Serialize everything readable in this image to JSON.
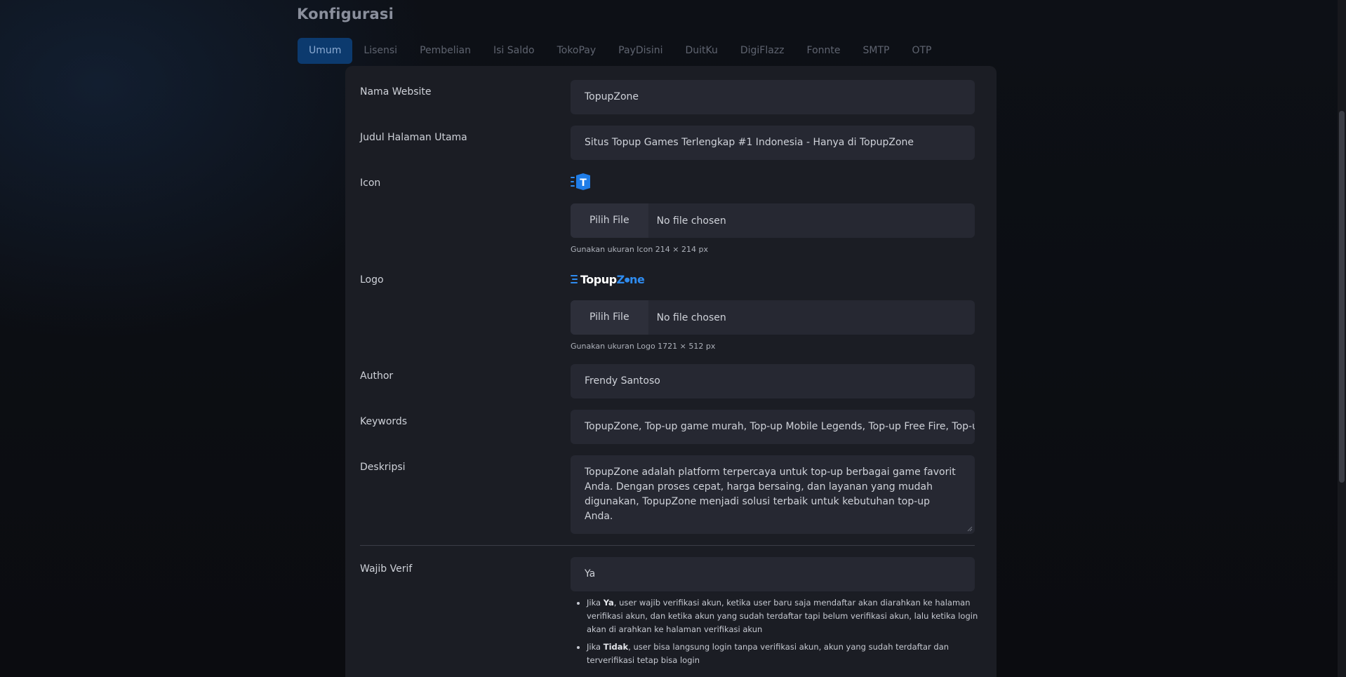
{
  "page": {
    "title": "Konfigurasi"
  },
  "tabs": [
    {
      "label": "Umum",
      "active": true
    },
    {
      "label": "Lisensi"
    },
    {
      "label": "Pembelian"
    },
    {
      "label": "Isi Saldo"
    },
    {
      "label": "TokoPay"
    },
    {
      "label": "PayDisini"
    },
    {
      "label": "DuitKu"
    },
    {
      "label": "DigiFlazz"
    },
    {
      "label": "Fonnte"
    },
    {
      "label": "SMTP"
    },
    {
      "label": "OTP"
    }
  ],
  "form": {
    "nama_website": {
      "label": "Nama Website",
      "value": "TopupZone"
    },
    "judul": {
      "label": "Judul Halaman Utama",
      "value": "Situs Topup Games Terlengkap #1 Indonesia - Hanya di TopupZone"
    },
    "icon": {
      "label": "Icon",
      "button": "Pilih File",
      "file": "No file chosen",
      "hint": "Gunakan ukuran Icon 214 × 214 px",
      "preview_letter": "T"
    },
    "logo": {
      "label": "Logo",
      "button": "Pilih File",
      "file": "No file chosen",
      "hint": "Gunakan ukuran Logo 1721 × 512 px",
      "brand_a": "Topup",
      "brand_z": "Z",
      "brand_b": "ne"
    },
    "author": {
      "label": "Author",
      "value": "Frendy Santoso"
    },
    "keywords": {
      "label": "Keywords",
      "value": "TopupZone, Top-up game murah, Top-up Mobile Legends, Top-up Free Fire, Top-up Ge"
    },
    "deskripsi": {
      "label": "Deskripsi",
      "value": "TopupZone adalah platform terpercaya untuk top-up berbagai game favorit Anda. Dengan proses cepat, harga bersaing, dan layanan yang mudah digunakan, TopupZone menjadi solusi terbaik untuk kebutuhan top-up Anda."
    },
    "wajib_verif": {
      "label": "Wajib Verif",
      "value": "Ya",
      "note_ya_prefix": "Jika ",
      "note_ya_bold": "Ya",
      "note_ya_text": ", user wajib verifikasi akun, ketika user baru saja mendaftar akan diarahkan ke halaman verifikasi akun, dan ketika akun yang sudah terdaftar tapi belum verifikasi akun, lalu ketika login akan di arahkan ke halaman verifikasi akun",
      "note_tidak_prefix": "Jika ",
      "note_tidak_bold": "Tidak",
      "note_tidak_text": ", user bisa langsung login tanpa verifikasi akun, akun yang sudah terdaftar dan terverifikasi tetap bisa login"
    }
  },
  "colors": {
    "accent": "#0c3a6e",
    "brand_blue": "#2f8cf0",
    "card": "#1b1d24",
    "input": "#262832"
  }
}
